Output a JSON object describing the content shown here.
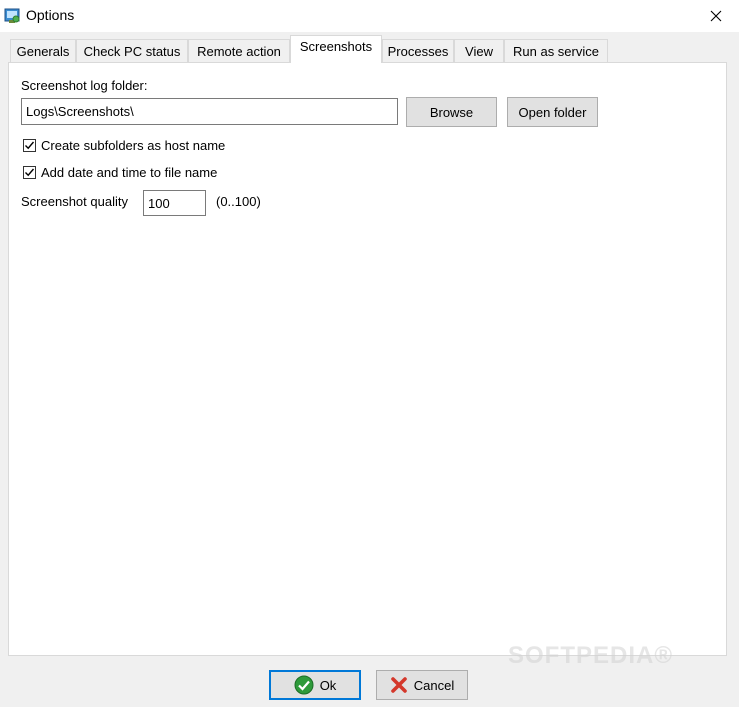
{
  "window": {
    "title": "Options",
    "icon": "app-icon",
    "close_icon": "close-icon"
  },
  "tabs": [
    {
      "label": "Generals",
      "active": false
    },
    {
      "label": "Check PC status",
      "active": false
    },
    {
      "label": "Remote action",
      "active": false
    },
    {
      "label": "Screenshots",
      "active": true
    },
    {
      "label": "Processes",
      "active": false
    },
    {
      "label": "View",
      "active": false
    },
    {
      "label": "Run as service",
      "active": false
    }
  ],
  "screenshots": {
    "log_folder_label": "Screenshot log folder:",
    "log_folder_value": "Logs\\Screenshots\\",
    "browse_label": "Browse",
    "open_folder_label": "Open folder",
    "subfolders_label": "Create subfolders as host name",
    "subfolders_checked": true,
    "datetime_label": "Add date and time to file name",
    "datetime_checked": true,
    "quality_label": "Screenshot quality",
    "quality_value": "100",
    "quality_range": "(0..100)"
  },
  "footer": {
    "ok_label": "Ok",
    "ok_icon": "check-icon",
    "cancel_label": "Cancel",
    "cancel_icon": "x-icon"
  },
  "watermark": "SOFTPEDIA®",
  "colors": {
    "accent": "#0078d7",
    "ok_icon": "#2e9a3a",
    "cancel_icon": "#d4382b"
  }
}
